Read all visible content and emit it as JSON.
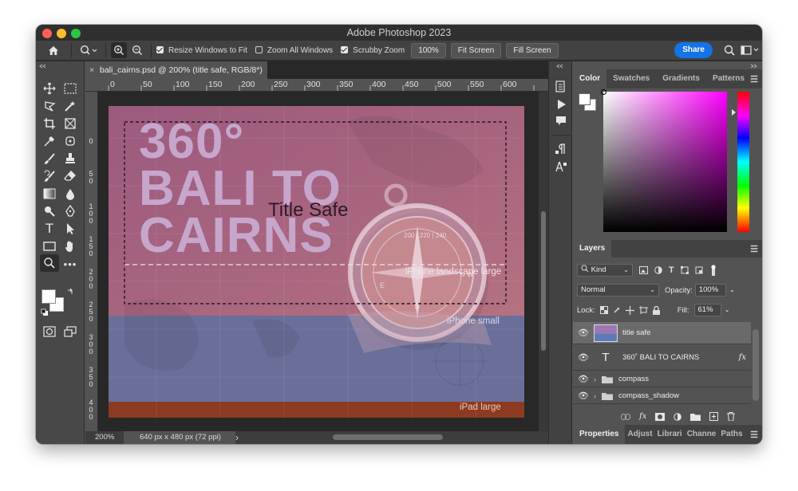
{
  "app": {
    "title": "Adobe Photoshop 2023"
  },
  "options": {
    "resize_windows": "Resize Windows to Fit",
    "zoom_all": "Zoom All Windows",
    "scrubby": "Scrubby Zoom",
    "zoom_value": "100%",
    "fit_screen": "Fit Screen",
    "fill_screen": "Fill Screen",
    "share": "Share"
  },
  "document": {
    "tab_title": "bali_cairns.psd @ 200% (title safe, RGB/8*)",
    "close_glyph": "×",
    "ruler_h": [
      "0",
      "50",
      "100",
      "150",
      "200",
      "250",
      "300",
      "350",
      "400",
      "450",
      "500",
      "550",
      "600"
    ],
    "ruler_v": [
      "0",
      "5 0",
      "1 0 0",
      "1 5 0",
      "2 0 0",
      "2 5 0",
      "3 0 0",
      "3 5 0",
      "4 0 0",
      "4 5 0"
    ]
  },
  "canvas": {
    "headline_1": "360°",
    "headline_2": "BALI TO",
    "headline_3": "CAIRNS",
    "title_safe": "Title Safe",
    "iphone_landscape": "iPhone landscape large",
    "iphone_small": "iPhone small",
    "ipad_large": "iPad large",
    "compass_ticks": "200 | 220 | 240",
    "compass_letter": "N W",
    "compass_e": "E",
    "compass_s": "S"
  },
  "status": {
    "zoom": "200%",
    "info": "640 px x 480 px (72 ppi)",
    "arrow": "›"
  },
  "color_panel": {
    "tabs": [
      "Color",
      "Swatches",
      "Gradients",
      "Patterns"
    ],
    "colors": {
      "hue": "#ff00ff",
      "foreground": "#ffffff",
      "background": "#ffffff"
    }
  },
  "layers_panel": {
    "tab": "Layers",
    "kind": "Kind",
    "blend": "Normal",
    "opacity_label": "Opacity:",
    "opacity_value": "100%",
    "lock_label": "Lock:",
    "fill_label": "Fill:",
    "fill_value": "61%",
    "layers": [
      {
        "name": "title safe"
      },
      {
        "name": "360˚  BALI TO CAIRNS"
      },
      {
        "name": "compass"
      },
      {
        "name": "compass_shadow"
      }
    ],
    "fx": "fx"
  },
  "bottom_tabs": [
    "Properties",
    "Adjust",
    "Librari",
    "Channe",
    "Paths"
  ]
}
